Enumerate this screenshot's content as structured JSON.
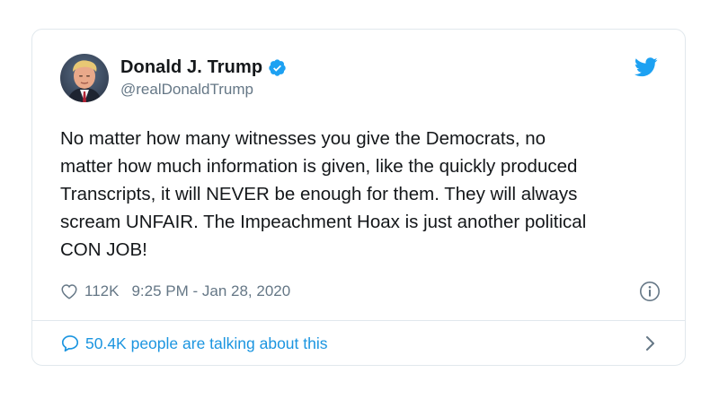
{
  "author": {
    "display_name": "Donald J. Trump",
    "handle": "@realDonaldTrump",
    "verified": true
  },
  "tweet": {
    "text": "No matter how many witnesses you give the Democrats, no\nmatter how much information is given, like the quickly produced\nTranscripts, it will NEVER be enough for them. They will always\nscream UNFAIR. The Impeachment Hoax is just another political\nCON JOB!",
    "likes": "112K",
    "timestamp": "9:25 PM - Jan 28, 2020"
  },
  "footer": {
    "conversation_label": "50.4K people are talking about this"
  },
  "icons": {
    "verified": "verified-badge-icon",
    "twitter": "twitter-bird-icon",
    "like": "heart-icon",
    "info": "info-icon",
    "reply": "speech-bubble-icon",
    "chevron": "chevron-right-icon"
  },
  "colors": {
    "text_primary": "#14171a",
    "text_secondary": "#657786",
    "accent_blue": "#1da1f2",
    "link_blue": "#1b95e0",
    "border": "#e1e8ed"
  }
}
